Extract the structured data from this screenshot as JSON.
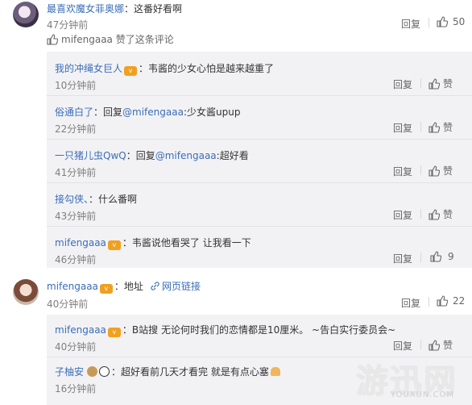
{
  "comments": [
    {
      "user": "最喜欢魔女菲奥娜",
      "text": "：这番好看啊",
      "time": "47分钟前",
      "reply_label": "回复",
      "likes": "50",
      "liked_by": "mifengaaa 赞了这条评论",
      "replies": [
        {
          "user": "我的冲绳女巨人",
          "text": "：韦酱的少女心怕是越来越重了",
          "time": "10分钟前",
          "reply_label": "回复",
          "like_label": "赞"
        },
        {
          "user": "俗通白了",
          "text": "：回复",
          "mention": "@mifengaaa",
          "text2": ":少女酱upup",
          "time": "22分钟前",
          "reply_label": "回复",
          "like_label": "赞"
        },
        {
          "user": "一只猪儿虫QwQ",
          "text": "：回复",
          "mention": "@mifengaaa",
          "text2": ":超好看",
          "time": "41分钟前",
          "reply_label": "回复",
          "like_label": "赞"
        },
        {
          "user": "接勾侠、",
          "text": "：什么番啊",
          "time": "43分钟前",
          "reply_label": "回复",
          "like_label": "赞"
        },
        {
          "user": "mifengaaa",
          "text": "：韦酱说他看哭了 让我看一下",
          "time": "46分钟前",
          "reply_label": "回复",
          "likes": "9"
        }
      ]
    },
    {
      "user": "mifengaaa",
      "text": "：地址",
      "link_label": "网页链接",
      "time": "40分钟前",
      "reply_label": "回复",
      "likes": "22",
      "replies": [
        {
          "user": "mifengaaa",
          "text": "：B站搜 无论何时我们的恋情都是10厘米。 ~告白实行委员会~",
          "time": "40分钟前",
          "reply_label": "回复",
          "like_label": "赞"
        },
        {
          "user": "子柚安",
          "text": "：超好看前几天才看完 就是有点心塞",
          "time": "16分钟前",
          "reply_label": "回复",
          "like_label": "赞"
        }
      ]
    }
  ],
  "watermark": {
    "main": "游迅网",
    "sub": "YOUXUN.COM"
  },
  "colors": {
    "link": "#3a6db7",
    "muted": "#808080",
    "reply_bg": "#f2f2f5"
  }
}
